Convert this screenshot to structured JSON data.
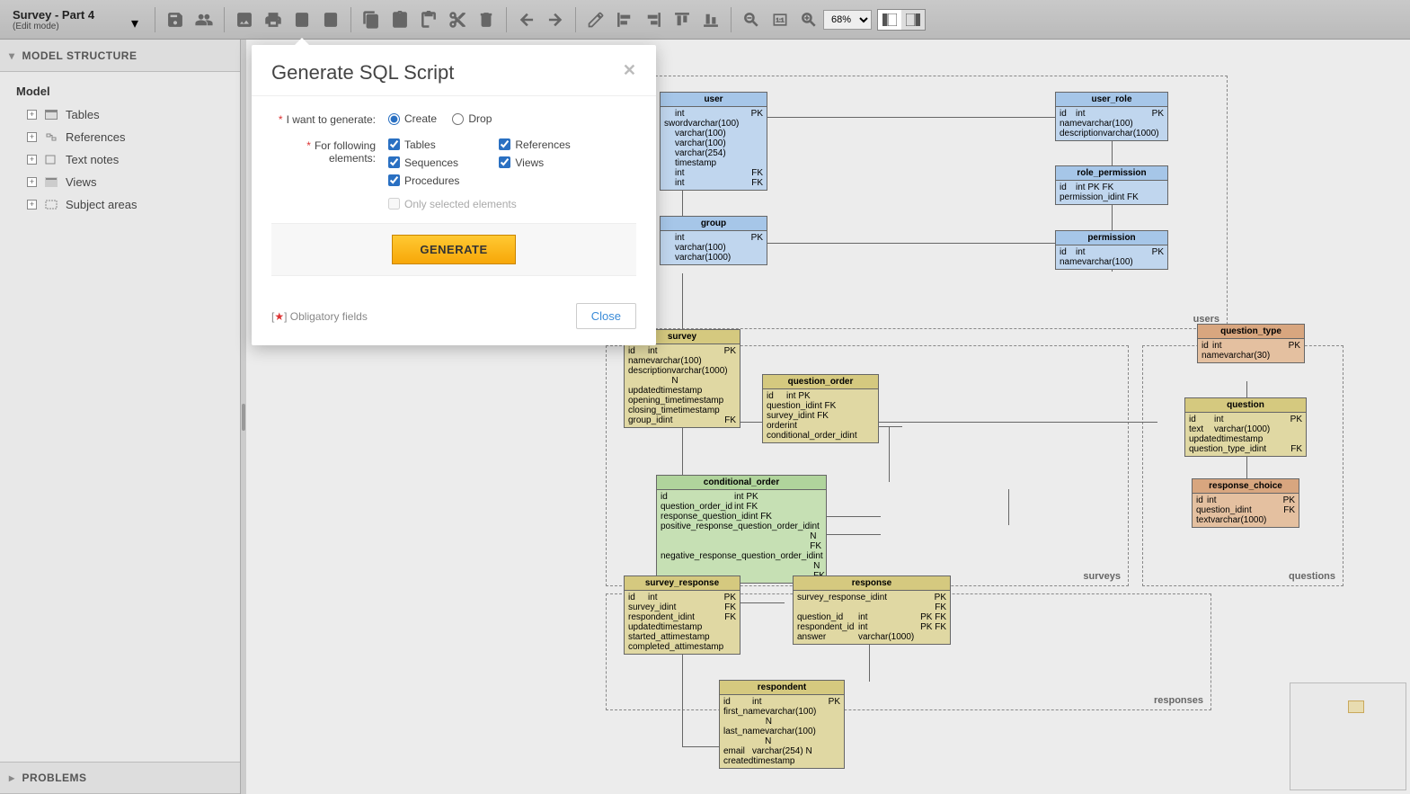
{
  "header": {
    "title": "Survey - Part 4",
    "subtitle": "(Edit mode)",
    "zoom": "68% "
  },
  "sidebar": {
    "panel_title": "MODEL STRUCTURE",
    "root": "Model",
    "items": [
      "Tables",
      "References",
      "Text notes",
      "Views",
      "Subject areas"
    ],
    "problems": "PROBLEMS"
  },
  "modal": {
    "title": "Generate SQL Script",
    "lbl_mode": "I want to generate:",
    "opt_create": "Create",
    "opt_drop": "Drop",
    "lbl_elements": "For following elements:",
    "chk_tables": "Tables",
    "chk_references": "References",
    "chk_sequences": "Sequences",
    "chk_views": "Views",
    "chk_procedures": "Procedures",
    "chk_only_selected": "Only selected elements",
    "btn_generate": "GENERATE",
    "obligatory": "Obligatory fields",
    "btn_close": "Close"
  },
  "areas": {
    "users": {
      "label": "users"
    },
    "surveys": {
      "label": "surveys"
    },
    "questions": {
      "label": "questions"
    },
    "responses": {
      "label": "responses"
    }
  },
  "entities": {
    "user": {
      "name": "user",
      "cols": [
        [
          "",
          "int",
          "PK"
        ],
        [
          "sword",
          "varchar(100)",
          ""
        ],
        [
          "",
          "varchar(100)",
          ""
        ],
        [
          "",
          "varchar(100)",
          ""
        ],
        [
          "",
          "varchar(254)",
          ""
        ],
        [
          "",
          "timestamp",
          ""
        ],
        [
          "",
          "int",
          "FK"
        ],
        [
          "",
          "int",
          "FK"
        ]
      ]
    },
    "user_role": {
      "name": "user_role",
      "cols": [
        [
          "id",
          "int",
          "PK"
        ],
        [
          "name",
          "varchar(100)",
          ""
        ],
        [
          "description",
          "varchar(1000)",
          ""
        ]
      ]
    },
    "role_permission": {
      "name": "role_permission",
      "cols": [
        [
          "id",
          "int PK FK",
          ""
        ],
        [
          "permission_id",
          "int FK",
          ""
        ]
      ]
    },
    "permission": {
      "name": "permission",
      "cols": [
        [
          "id",
          "int",
          "PK"
        ],
        [
          "name",
          "varchar(100)",
          ""
        ]
      ]
    },
    "group": {
      "name": "group",
      "cols": [
        [
          "",
          "int",
          "PK"
        ],
        [
          "",
          "varchar(100)",
          ""
        ],
        [
          "",
          "varchar(1000)",
          ""
        ]
      ]
    },
    "survey": {
      "name": "survey",
      "cols": [
        [
          "id",
          "int",
          "PK"
        ],
        [
          "name",
          "varchar(100)",
          ""
        ],
        [
          "description",
          "varchar(1000) N",
          ""
        ],
        [
          "updated",
          "timestamp",
          ""
        ],
        [
          "opening_time",
          "timestamp",
          ""
        ],
        [
          "closing_time",
          "timestamp",
          ""
        ],
        [
          "group_id",
          "int",
          "FK"
        ]
      ]
    },
    "question_order": {
      "name": "question_order",
      "cols": [
        [
          "id",
          "int PK",
          ""
        ],
        [
          "question_id",
          "int FK",
          ""
        ],
        [
          "survey_id",
          "int FK",
          ""
        ],
        [
          "order",
          "int",
          ""
        ],
        [
          "conditional_order_id",
          "int",
          ""
        ]
      ]
    },
    "conditional_order": {
      "name": "conditional_order",
      "cols": [
        [
          "id",
          "int PK",
          ""
        ],
        [
          "question_order_id",
          "int FK",
          ""
        ],
        [
          "response_question_id",
          "int FK",
          ""
        ],
        [
          "positive_response_question_order_id",
          "int N FK",
          ""
        ],
        [
          "negative_response_question_order_id",
          "int N FK",
          ""
        ]
      ]
    },
    "question_type": {
      "name": "question_type",
      "cols": [
        [
          "id",
          "int",
          "PK"
        ],
        [
          "name",
          "varchar(30)",
          ""
        ]
      ]
    },
    "question": {
      "name": "question",
      "cols": [
        [
          "id",
          "int",
          "PK"
        ],
        [
          "text",
          "varchar(1000)",
          ""
        ],
        [
          "updated",
          "timestamp",
          ""
        ],
        [
          "question_type_id",
          "int",
          "FK"
        ]
      ]
    },
    "response_choice": {
      "name": "response_choice",
      "cols": [
        [
          "id",
          "int",
          "PK"
        ],
        [
          "question_id",
          "int",
          "FK"
        ],
        [
          "text",
          "varchar(1000)",
          ""
        ]
      ]
    },
    "survey_response": {
      "name": "survey_response",
      "cols": [
        [
          "id",
          "int",
          "PK"
        ],
        [
          "survey_id",
          "int",
          "FK"
        ],
        [
          "respondent_id",
          "int",
          "FK"
        ],
        [
          "updated",
          "timestamp",
          ""
        ],
        [
          "started_at",
          "timestamp",
          ""
        ],
        [
          "completed_at",
          "timestamp",
          ""
        ]
      ]
    },
    "response": {
      "name": "response",
      "cols": [
        [
          "survey_response_id",
          "int",
          "PK FK"
        ],
        [
          "question_id",
          "int",
          "PK FK"
        ],
        [
          "respondent_id",
          "int",
          "PK FK"
        ],
        [
          "answer",
          "varchar(1000)",
          ""
        ]
      ]
    },
    "respondent": {
      "name": "respondent",
      "cols": [
        [
          "id",
          "int",
          "PK"
        ],
        [
          "first_name",
          "varchar(100) N",
          ""
        ],
        [
          "last_name",
          "varchar(100) N",
          ""
        ],
        [
          "email",
          "varchar(254) N",
          ""
        ],
        [
          "created",
          "timestamp",
          ""
        ]
      ]
    }
  }
}
